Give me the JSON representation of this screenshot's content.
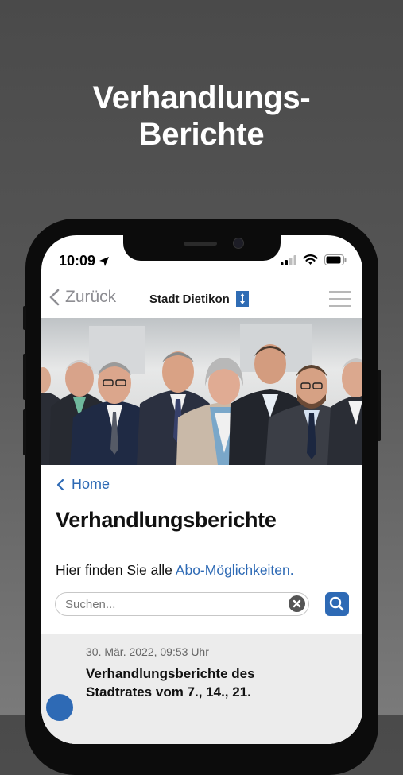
{
  "promo": {
    "title_line1": "Verhandlungs-",
    "title_line2": "Berichte"
  },
  "status_bar": {
    "time": "10:09"
  },
  "navbar": {
    "back_label": "Zurück",
    "brand_name": "Stadt Dietikon"
  },
  "content": {
    "home_link": "Home",
    "heading": "Verhandlungsberichte",
    "intro_text": "Hier finden Sie alle ",
    "intro_link": "Abo-Möglichkeiten.",
    "search": {
      "placeholder": "Suchen..."
    },
    "items": [
      {
        "date": "30. Mär. 2022, 09:53 Uhr",
        "title": "Verhandlungsberichte des Stadtrates vom 7., 14., 21."
      }
    ]
  },
  "colors": {
    "accent": "#2e6ab5",
    "background_top": "#4a4a4a",
    "list_bg": "#ececec"
  }
}
